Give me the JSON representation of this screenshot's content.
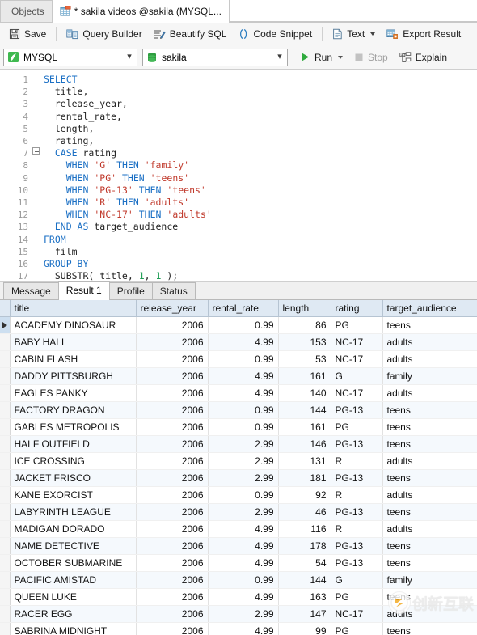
{
  "window": {
    "tabs": [
      {
        "label": "Objects",
        "icon": "objects-icon",
        "active": false
      },
      {
        "label": "* sakila videos @sakila (MYSQL...",
        "icon": "query-grid-icon",
        "active": true
      }
    ]
  },
  "toolbar": {
    "save_label": "Save",
    "query_builder_label": "Query Builder",
    "beautify_sql_label": "Beautify SQL",
    "code_snippet_label": "Code Snippet",
    "text_label": "Text",
    "export_result_label": "Export Result"
  },
  "connbar": {
    "connection_value": "MYSQL",
    "database_value": "sakila",
    "run_label": "Run",
    "stop_label": "Stop",
    "explain_label": "Explain"
  },
  "editor": {
    "line_numbers": [
      "1",
      "2",
      "3",
      "4",
      "5",
      "6",
      "7",
      "8",
      "9",
      "10",
      "11",
      "12",
      "13",
      "14",
      "15",
      "16",
      "17"
    ],
    "sql_text": "SELECT\n  title,\n  release_year,\n  rental_rate,\n  length,\n  rating,\n  CASE rating\n    WHEN 'G' THEN 'family'\n    WHEN 'PG' THEN 'teens'\n    WHEN 'PG-13' THEN 'teens'\n    WHEN 'R' THEN 'adults'\n    WHEN 'NC-17' THEN 'adults'\n  END AS target_audience\nFROM\n  film\nGROUP BY\n  SUBSTR( title, 1, 1 );",
    "lines": [
      {
        "n": "1",
        "tokens": [
          {
            "t": "SELECT",
            "c": "k"
          }
        ]
      },
      {
        "n": "2",
        "tokens": [
          {
            "t": "  title,",
            "c": "id"
          }
        ]
      },
      {
        "n": "3",
        "tokens": [
          {
            "t": "  release_year,",
            "c": "id"
          }
        ]
      },
      {
        "n": "4",
        "tokens": [
          {
            "t": "  rental_rate,",
            "c": "id"
          }
        ]
      },
      {
        "n": "5",
        "tokens": [
          {
            "t": "  length,",
            "c": "id"
          }
        ]
      },
      {
        "n": "6",
        "tokens": [
          {
            "t": "  rating,",
            "c": "id"
          }
        ]
      },
      {
        "n": "7",
        "tokens": [
          {
            "t": "  ",
            "c": "id"
          },
          {
            "t": "CASE",
            "c": "k"
          },
          {
            "t": " rating",
            "c": "id"
          }
        ]
      },
      {
        "n": "8",
        "tokens": [
          {
            "t": "    ",
            "c": "id"
          },
          {
            "t": "WHEN",
            "c": "k"
          },
          {
            "t": " ",
            "c": "id"
          },
          {
            "t": "'G'",
            "c": "s"
          },
          {
            "t": " ",
            "c": "id"
          },
          {
            "t": "THEN",
            "c": "k"
          },
          {
            "t": " ",
            "c": "id"
          },
          {
            "t": "'family'",
            "c": "s"
          }
        ]
      },
      {
        "n": "9",
        "tokens": [
          {
            "t": "    ",
            "c": "id"
          },
          {
            "t": "WHEN",
            "c": "k"
          },
          {
            "t": " ",
            "c": "id"
          },
          {
            "t": "'PG'",
            "c": "s"
          },
          {
            "t": " ",
            "c": "id"
          },
          {
            "t": "THEN",
            "c": "k"
          },
          {
            "t": " ",
            "c": "id"
          },
          {
            "t": "'teens'",
            "c": "s"
          }
        ]
      },
      {
        "n": "10",
        "tokens": [
          {
            "t": "    ",
            "c": "id"
          },
          {
            "t": "WHEN",
            "c": "k"
          },
          {
            "t": " ",
            "c": "id"
          },
          {
            "t": "'PG-13'",
            "c": "s"
          },
          {
            "t": " ",
            "c": "id"
          },
          {
            "t": "THEN",
            "c": "k"
          },
          {
            "t": " ",
            "c": "id"
          },
          {
            "t": "'teens'",
            "c": "s"
          }
        ]
      },
      {
        "n": "11",
        "tokens": [
          {
            "t": "    ",
            "c": "id"
          },
          {
            "t": "WHEN",
            "c": "k"
          },
          {
            "t": " ",
            "c": "id"
          },
          {
            "t": "'R'",
            "c": "s"
          },
          {
            "t": " ",
            "c": "id"
          },
          {
            "t": "THEN",
            "c": "k"
          },
          {
            "t": " ",
            "c": "id"
          },
          {
            "t": "'adults'",
            "c": "s"
          }
        ]
      },
      {
        "n": "12",
        "tokens": [
          {
            "t": "    ",
            "c": "id"
          },
          {
            "t": "WHEN",
            "c": "k"
          },
          {
            "t": " ",
            "c": "id"
          },
          {
            "t": "'NC-17'",
            "c": "s"
          },
          {
            "t": " ",
            "c": "id"
          },
          {
            "t": "THEN",
            "c": "k"
          },
          {
            "t": " ",
            "c": "id"
          },
          {
            "t": "'adults'",
            "c": "s"
          }
        ]
      },
      {
        "n": "13",
        "tokens": [
          {
            "t": "  ",
            "c": "id"
          },
          {
            "t": "END AS",
            "c": "k"
          },
          {
            "t": " target_audience",
            "c": "id"
          }
        ]
      },
      {
        "n": "14",
        "tokens": [
          {
            "t": "FROM",
            "c": "k"
          }
        ]
      },
      {
        "n": "15",
        "tokens": [
          {
            "t": "  film",
            "c": "id"
          }
        ]
      },
      {
        "n": "16",
        "tokens": [
          {
            "t": "GROUP BY",
            "c": "k"
          }
        ]
      },
      {
        "n": "17",
        "tokens": [
          {
            "t": "  SUBSTR( title, ",
            "c": "id"
          },
          {
            "t": "1",
            "c": "n"
          },
          {
            "t": ", ",
            "c": "id"
          },
          {
            "t": "1",
            "c": "n"
          },
          {
            "t": " );",
            "c": "id"
          }
        ]
      }
    ]
  },
  "result_tabs": [
    {
      "label": "Message",
      "active": false
    },
    {
      "label": "Result 1",
      "active": true
    },
    {
      "label": "Profile",
      "active": false
    },
    {
      "label": "Status",
      "active": false
    }
  ],
  "grid": {
    "columns": [
      "title",
      "release_year",
      "rental_rate",
      "length",
      "rating",
      "target_audience"
    ],
    "rows": [
      [
        "ACADEMY DINOSAUR",
        "2006",
        "0.99",
        "86",
        "PG",
        "teens"
      ],
      [
        "BABY HALL",
        "2006",
        "4.99",
        "153",
        "NC-17",
        "adults"
      ],
      [
        "CABIN FLASH",
        "2006",
        "0.99",
        "53",
        "NC-17",
        "adults"
      ],
      [
        "DADDY PITTSBURGH",
        "2006",
        "4.99",
        "161",
        "G",
        "family"
      ],
      [
        "EAGLES PANKY",
        "2006",
        "4.99",
        "140",
        "NC-17",
        "adults"
      ],
      [
        "FACTORY DRAGON",
        "2006",
        "0.99",
        "144",
        "PG-13",
        "teens"
      ],
      [
        "GABLES METROPOLIS",
        "2006",
        "0.99",
        "161",
        "PG",
        "teens"
      ],
      [
        "HALF OUTFIELD",
        "2006",
        "2.99",
        "146",
        "PG-13",
        "teens"
      ],
      [
        "ICE CROSSING",
        "2006",
        "2.99",
        "131",
        "R",
        "adults"
      ],
      [
        "JACKET FRISCO",
        "2006",
        "2.99",
        "181",
        "PG-13",
        "teens"
      ],
      [
        "KANE EXORCIST",
        "2006",
        "0.99",
        "92",
        "R",
        "adults"
      ],
      [
        "LABYRINTH LEAGUE",
        "2006",
        "2.99",
        "46",
        "PG-13",
        "teens"
      ],
      [
        "MADIGAN DORADO",
        "2006",
        "4.99",
        "116",
        "R",
        "adults"
      ],
      [
        "NAME DETECTIVE",
        "2006",
        "4.99",
        "178",
        "PG-13",
        "teens"
      ],
      [
        "OCTOBER SUBMARINE",
        "2006",
        "4.99",
        "54",
        "PG-13",
        "teens"
      ],
      [
        "PACIFIC AMISTAD",
        "2006",
        "0.99",
        "144",
        "G",
        "family"
      ],
      [
        "QUEEN LUKE",
        "2006",
        "4.99",
        "163",
        "PG",
        "teens"
      ],
      [
        "RACER EGG",
        "2006",
        "2.99",
        "147",
        "NC-17",
        "adults"
      ],
      [
        "SABRINA MIDNIGHT",
        "2006",
        "4.99",
        "99",
        "PG",
        "teens"
      ]
    ],
    "current_row_index": 0
  },
  "watermark": {
    "text": "创新互联"
  },
  "colors": {
    "accent_green": "#2faa3d",
    "keyword_blue": "#1a6fc4",
    "string_red": "#c0392b",
    "number_green": "#1f9e55",
    "header_bg": "#dfe9f3",
    "alt_row": "#f5f9fd"
  }
}
